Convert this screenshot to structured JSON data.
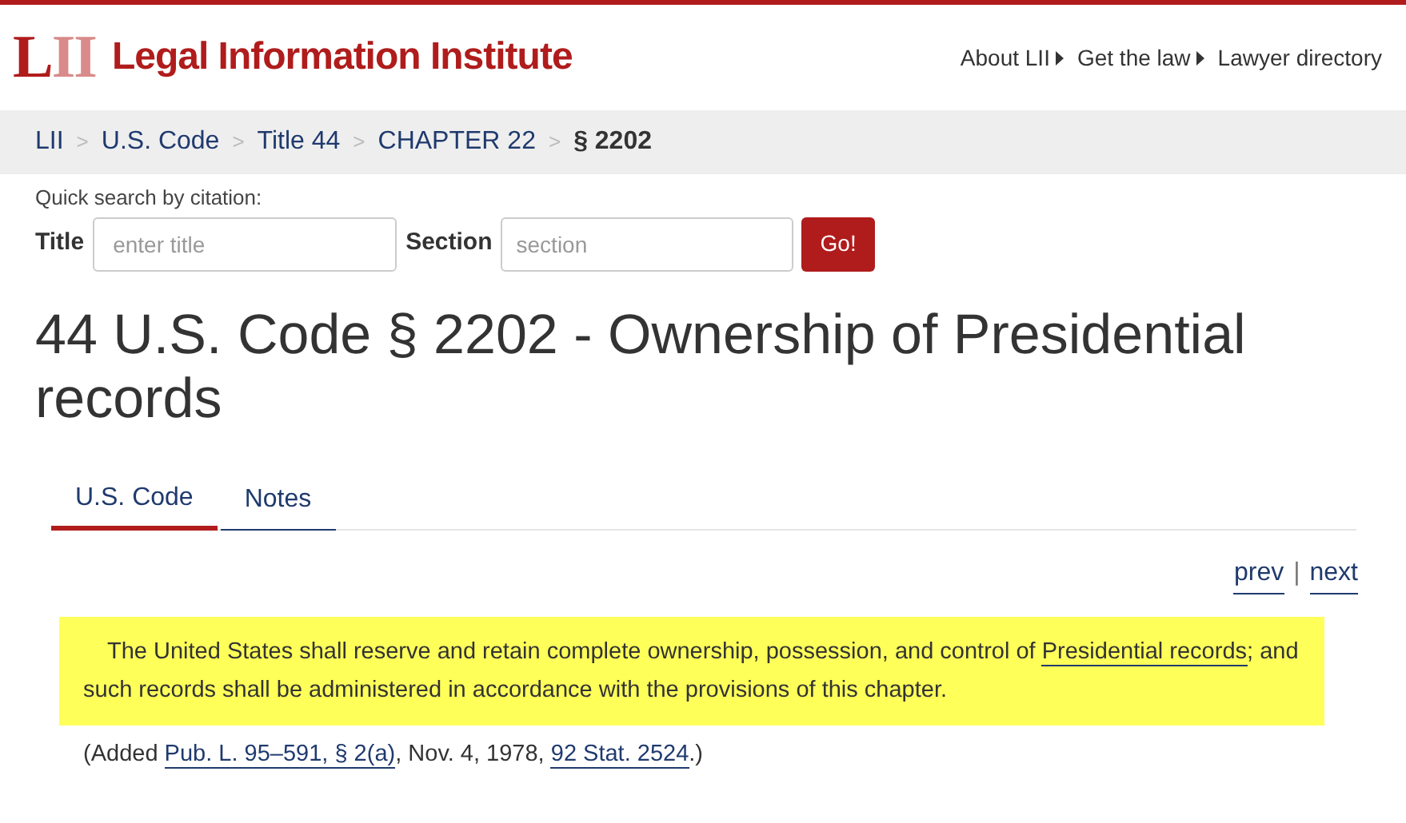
{
  "logo": {
    "letters": [
      {
        "char": "L",
        "color": "#b01c1c"
      },
      {
        "char": "I",
        "color": "#d98a8a"
      },
      {
        "char": "I",
        "color": "#d98a8a"
      }
    ],
    "name": "Legal Information Institute"
  },
  "top_nav": [
    {
      "label": "About LII",
      "caret": true
    },
    {
      "label": "Get the law",
      "caret": true
    },
    {
      "label": "Lawyer directory",
      "caret": false
    }
  ],
  "breadcrumb": [
    {
      "label": "LII",
      "current": false
    },
    {
      "label": "U.S. Code",
      "current": false
    },
    {
      "label": "Title 44",
      "current": false
    },
    {
      "label": "CHAPTER 22",
      "current": false
    },
    {
      "label": "§ 2202",
      "current": true
    }
  ],
  "breadcrumb_separator": ">",
  "quick_search": {
    "heading": "Quick search by citation:",
    "title_label": "Title",
    "title_placeholder": "enter title",
    "section_label": "Section",
    "section_placeholder": "section",
    "button": "Go!"
  },
  "page_title": "44 U.S. Code § 2202 - Ownership of Presidential records",
  "tabs": [
    {
      "label": "U.S. Code",
      "selected": true
    },
    {
      "label": "Notes",
      "selected": false
    }
  ],
  "pager": {
    "prev": "prev",
    "separator": "|",
    "next": "next"
  },
  "statute": {
    "before": "The United States shall reserve and retain complete ownership, possession, and control of ",
    "link": "Presidential records",
    "after": "; and such records shall be administered in accordance with the provisions of this chapter.",
    "highlighted": true
  },
  "source_note": {
    "before": "(Added ",
    "link_1": "Pub. L. 95–591, § 2(a)",
    "middle": ", Nov. 4, 1978, ",
    "link_2": "92 Stat. 2524",
    "after": ".)"
  }
}
